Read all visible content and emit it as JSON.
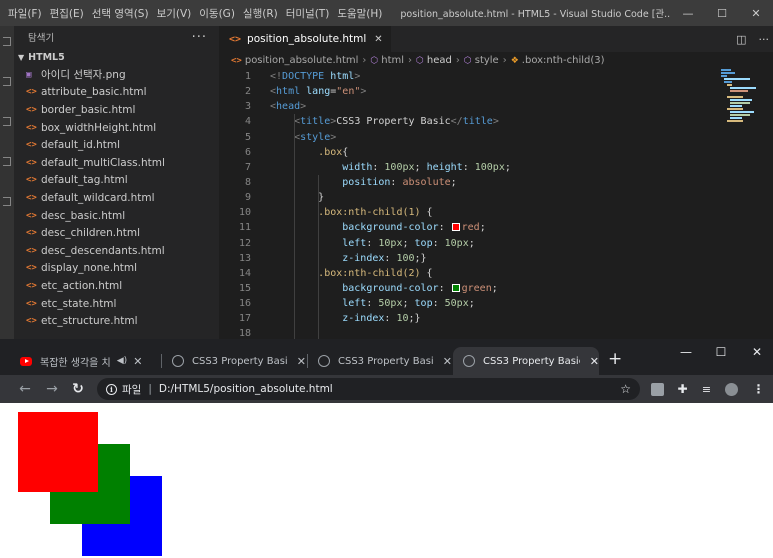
{
  "vscode": {
    "menu": [
      "파일(F)",
      "편집(E)",
      "선택 영역(S)",
      "보기(V)",
      "이동(G)",
      "실행(R)",
      "터미널(T)",
      "도움말(H)"
    ],
    "window_title": "position_absolute.html - HTML5 - Visual Studio Code [관...",
    "window_controls": [
      "—",
      "☐",
      "✕"
    ],
    "explorer_label": "탐색기",
    "explorer_more": "···",
    "folder": "HTML5",
    "files": [
      {
        "name": "아이디 선택자.png",
        "icon": "image-icon"
      },
      {
        "name": "attribute_basic.html",
        "icon": "html-icon"
      },
      {
        "name": "border_basic.html",
        "icon": "html-icon"
      },
      {
        "name": "box_widthHeight.html",
        "icon": "html-icon"
      },
      {
        "name": "default_id.html",
        "icon": "html-icon"
      },
      {
        "name": "default_multiClass.html",
        "icon": "html-icon"
      },
      {
        "name": "default_tag.html",
        "icon": "html-icon"
      },
      {
        "name": "default_wildcard.html",
        "icon": "html-icon"
      },
      {
        "name": "desc_basic.html",
        "icon": "html-icon"
      },
      {
        "name": "desc_children.html",
        "icon": "html-icon"
      },
      {
        "name": "desc_descendants.html",
        "icon": "html-icon"
      },
      {
        "name": "display_none.html",
        "icon": "html-icon"
      },
      {
        "name": "etc_action.html",
        "icon": "html-icon"
      },
      {
        "name": "etc_state.html",
        "icon": "html-icon"
      },
      {
        "name": "etc_structure.html",
        "icon": "html-icon"
      }
    ],
    "tab": {
      "name": "position_absolute.html",
      "close": "✕"
    },
    "breadcrumb": [
      "position_absolute.html",
      "html",
      "head",
      "style",
      ".box:nth-child(3)"
    ],
    "code_lines": [
      {
        "n": "1",
        "tokens": [
          [
            "t-gray",
            "<!"
          ],
          [
            "t-tag",
            "DOCTYPE"
          ],
          [
            "t-txt",
            " "
          ],
          [
            "t-attr",
            "html"
          ],
          [
            "t-gray",
            ">"
          ]
        ]
      },
      {
        "n": "2",
        "tokens": [
          [
            "t-gray",
            "<"
          ],
          [
            "t-tag",
            "html"
          ],
          [
            "t-txt",
            " "
          ],
          [
            "t-attr",
            "lang"
          ],
          [
            "t-pun",
            "="
          ],
          [
            "t-str",
            "\"en\""
          ],
          [
            "t-gray",
            ">"
          ]
        ]
      },
      {
        "n": "3",
        "tokens": [
          [
            "t-gray",
            "<"
          ],
          [
            "t-tag",
            "head"
          ],
          [
            "t-gray",
            ">"
          ]
        ]
      },
      {
        "n": "4",
        "tokens": [
          [
            "t-txt",
            "    "
          ],
          [
            "t-gray",
            "<"
          ],
          [
            "t-tag",
            "title"
          ],
          [
            "t-gray",
            ">"
          ],
          [
            "t-txt",
            "CSS3 Property Basic"
          ],
          [
            "t-gray",
            "</"
          ],
          [
            "t-tag",
            "title"
          ],
          [
            "t-gray",
            ">"
          ]
        ]
      },
      {
        "n": "5",
        "tokens": [
          [
            "t-txt",
            "    "
          ],
          [
            "t-gray",
            "<"
          ],
          [
            "t-tag",
            "style"
          ],
          [
            "t-gray",
            ">"
          ]
        ]
      },
      {
        "n": "6",
        "tokens": [
          [
            "t-txt",
            "        "
          ],
          [
            "t-sel",
            ".box"
          ],
          [
            "t-pun",
            "{"
          ]
        ]
      },
      {
        "n": "7",
        "tokens": [
          [
            "t-txt",
            "            "
          ],
          [
            "t-prop",
            "width"
          ],
          [
            "t-pun",
            ": "
          ],
          [
            "t-num",
            "100px"
          ],
          [
            "t-pun",
            "; "
          ],
          [
            "t-prop",
            "height"
          ],
          [
            "t-pun",
            ": "
          ],
          [
            "t-num",
            "100px"
          ],
          [
            "t-pun",
            ";"
          ]
        ]
      },
      {
        "n": "8",
        "tokens": [
          [
            "t-txt",
            "            "
          ],
          [
            "t-prop",
            "position"
          ],
          [
            "t-pun",
            ": "
          ],
          [
            "t-val",
            "absolute"
          ],
          [
            "t-pun",
            ";"
          ]
        ]
      },
      {
        "n": "9",
        "tokens": [
          [
            "t-txt",
            "        "
          ],
          [
            "t-pun",
            "}"
          ]
        ]
      },
      {
        "n": "10",
        "tokens": [
          [
            "t-txt",
            "        "
          ],
          [
            "t-sel",
            ".box:nth-child(1)"
          ],
          [
            "t-pun",
            " {"
          ]
        ]
      },
      {
        "n": "11",
        "tokens": [
          [
            "t-txt",
            "            "
          ],
          [
            "t-prop",
            "background-color"
          ],
          [
            "t-pun",
            ": "
          ],
          [
            "swatch",
            "#ff0000"
          ],
          [
            "t-val",
            "red"
          ],
          [
            "t-pun",
            ";"
          ]
        ]
      },
      {
        "n": "12",
        "tokens": [
          [
            "t-txt",
            "            "
          ],
          [
            "t-prop",
            "left"
          ],
          [
            "t-pun",
            ": "
          ],
          [
            "t-num",
            "10px"
          ],
          [
            "t-pun",
            "; "
          ],
          [
            "t-prop",
            "top"
          ],
          [
            "t-pun",
            ": "
          ],
          [
            "t-num",
            "10px"
          ],
          [
            "t-pun",
            ";"
          ]
        ]
      },
      {
        "n": "13",
        "tokens": [
          [
            "t-txt",
            "            "
          ],
          [
            "t-prop",
            "z-index"
          ],
          [
            "t-pun",
            ": "
          ],
          [
            "t-num",
            "100"
          ],
          [
            "t-pun",
            ";}"
          ]
        ]
      },
      {
        "n": "14",
        "tokens": [
          [
            "t-txt",
            "        "
          ],
          [
            "t-sel",
            ".box:nth-child(2)"
          ],
          [
            "t-pun",
            " {"
          ]
        ]
      },
      {
        "n": "15",
        "tokens": [
          [
            "t-txt",
            "            "
          ],
          [
            "t-prop",
            "background-color"
          ],
          [
            "t-pun",
            ": "
          ],
          [
            "swatch",
            "#008000"
          ],
          [
            "t-val",
            "green"
          ],
          [
            "t-pun",
            ";"
          ]
        ]
      },
      {
        "n": "16",
        "tokens": [
          [
            "t-txt",
            "            "
          ],
          [
            "t-prop",
            "left"
          ],
          [
            "t-pun",
            ": "
          ],
          [
            "t-num",
            "50px"
          ],
          [
            "t-pun",
            "; "
          ],
          [
            "t-prop",
            "top"
          ],
          [
            "t-pun",
            ": "
          ],
          [
            "t-num",
            "50px"
          ],
          [
            "t-pun",
            ";"
          ]
        ]
      },
      {
        "n": "17",
        "tokens": [
          [
            "t-txt",
            "            "
          ],
          [
            "t-prop",
            "z-index"
          ],
          [
            "t-pun",
            ": "
          ],
          [
            "t-num",
            "10"
          ],
          [
            "t-pun",
            ";}"
          ]
        ]
      },
      {
        "n": "18",
        "tokens": []
      }
    ]
  },
  "chrome": {
    "tabs": [
      {
        "title": "복잡한 생각을 치",
        "favicon": "youtube-icon",
        "audio": "◀)"
      },
      {
        "title": "CSS3 Property Basic",
        "favicon": "globe-icon"
      },
      {
        "title": "CSS3 Property Basic",
        "favicon": "globe-icon"
      },
      {
        "title": "CSS3 Property Basic",
        "favicon": "globe-icon",
        "active": true
      }
    ],
    "tab_close": "✕",
    "new_tab": "+",
    "window_controls": [
      "—",
      "☐",
      "✕"
    ],
    "nav": {
      "back": "←",
      "forward": "→",
      "reload": "↻"
    },
    "address": {
      "info": "i",
      "scheme": "파일",
      "url": "D:/HTML5/position_absolute.html",
      "star": "☆"
    },
    "boxes": [
      {
        "color": "#ff0000",
        "name": "red-box"
      },
      {
        "color": "#008000",
        "name": "green-box"
      },
      {
        "color": "#0000ff",
        "name": "blue-box"
      }
    ]
  }
}
